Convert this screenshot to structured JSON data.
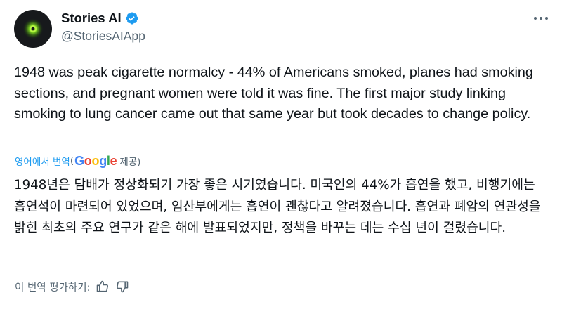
{
  "author": {
    "display_name": "Stories AI",
    "handle": "@StoriesAIApp",
    "verified": true,
    "avatar_icon": "green-glow-orb-icon"
  },
  "tweet": {
    "text": "1948 was peak cigarette normalcy - 44% of Americans smoked, planes had smoking sections, and pregnant women were told it was fine. The first major study linking smoking to lung cancer came out that same year but took decades to change policy."
  },
  "translation": {
    "label": "영어에서 번역",
    "open_paren": "(",
    "provider_letters": [
      "G",
      "o",
      "o",
      "g",
      "l",
      "e"
    ],
    "powered_by": " 제공)",
    "text": "1948년은 담배가 정상화되기 가장 좋은 시기였습니다. 미국인의 44%가 흡연을 했고, 비행기에는 흡연석이 마련되어 있었으며, 임산부에게는 흡연이 괜찮다고 알려졌습니다. 흡연과 폐암의 연관성을 밝힌 최초의 주요 연구가 같은 해에 발표되었지만, 정책을 바꾸는 데는 수십 년이 걸렸습니다.",
    "rate_label": "이 번역 평가하기:"
  },
  "colors": {
    "text_primary": "#0f1419",
    "text_secondary": "#536471",
    "link_blue": "#1d9bf0",
    "verified_blue": "#1d9bf0"
  }
}
